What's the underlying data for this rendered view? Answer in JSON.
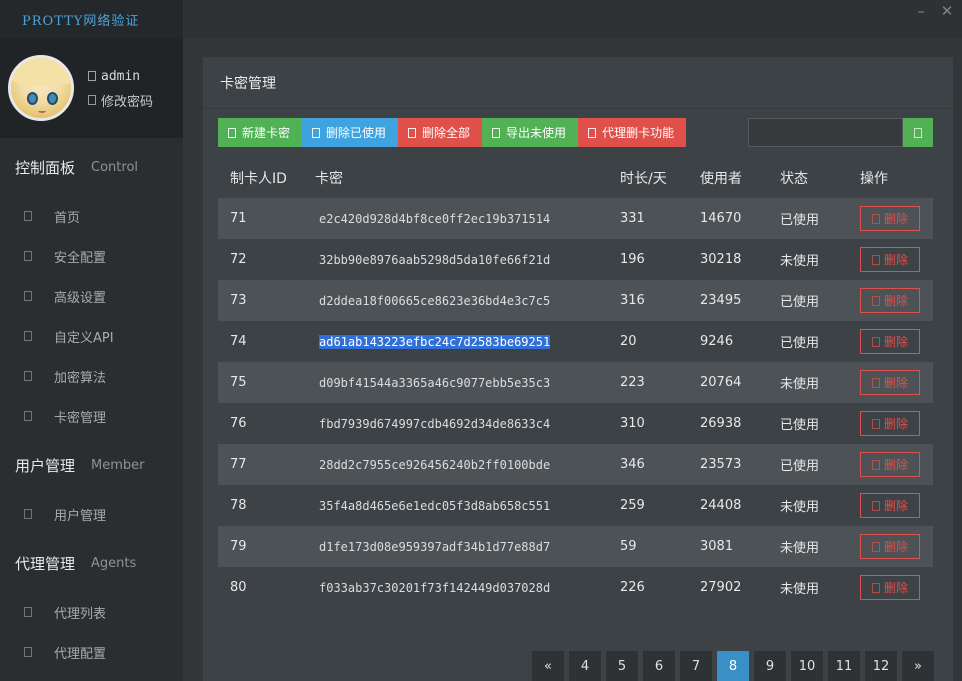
{
  "brand": "PROTTY网络验证",
  "window_controls": {
    "minimize": "–",
    "close": "✕"
  },
  "profile": {
    "username": "admin",
    "change_password": "修改密码"
  },
  "sidebar": {
    "groups": [
      {
        "title": "控制面板",
        "en": "Control",
        "items": [
          "首页",
          "安全配置",
          "高级设置",
          "自定义API",
          "加密算法",
          "卡密管理"
        ]
      },
      {
        "title": "用户管理",
        "en": "Member",
        "items": [
          "用户管理"
        ]
      },
      {
        "title": "代理管理",
        "en": "Agents",
        "items": [
          "代理列表",
          "代理配置"
        ]
      }
    ]
  },
  "panel": {
    "title": "卡密管理"
  },
  "toolbar": {
    "new_card": "新建卡密",
    "delete_used": "删除已使用",
    "delete_all": "删除全部",
    "export_unused": "导出未使用",
    "agent_delete": "代理删卡功能"
  },
  "search": {
    "value": ""
  },
  "table": {
    "headers": {
      "id": "制卡人ID",
      "key": "卡密",
      "duration": "时长/天",
      "user": "使用者",
      "status": "状态",
      "op": "操作"
    },
    "delete_label": "删除",
    "rows": [
      {
        "id": "71",
        "key": "e2c420d928d4bf8ce0ff2ec19b371514",
        "duration": "331",
        "user": "14670",
        "status": "已使用"
      },
      {
        "id": "72",
        "key": "32bb90e8976aab5298d5da10fe66f21d",
        "duration": "196",
        "user": "30218",
        "status": "未使用"
      },
      {
        "id": "73",
        "key": "d2ddea18f00665ce8623e36bd4e3c7c5",
        "duration": "316",
        "user": "23495",
        "status": "已使用"
      },
      {
        "id": "74",
        "key": "ad61ab143223efbc24c7d2583be69251",
        "duration": "20",
        "user": "9246",
        "status": "已使用",
        "selected": true
      },
      {
        "id": "75",
        "key": "d09bf41544a3365a46c9077ebb5e35c3",
        "duration": "223",
        "user": "20764",
        "status": "未使用"
      },
      {
        "id": "76",
        "key": "fbd7939d674997cdb4692d34de8633c4",
        "duration": "310",
        "user": "26938",
        "status": "已使用"
      },
      {
        "id": "77",
        "key": "28dd2c7955ce926456240b2ff0100bde",
        "duration": "346",
        "user": "23573",
        "status": "已使用"
      },
      {
        "id": "78",
        "key": "35f4a8d465e6e1edc05f3d8ab658c551",
        "duration": "259",
        "user": "24408",
        "status": "未使用"
      },
      {
        "id": "79",
        "key": "d1fe173d08e959397adf34b1d77e88d7",
        "duration": "59",
        "user": "3081",
        "status": "未使用"
      },
      {
        "id": "80",
        "key": "f033ab37c30201f73f142449d037028d",
        "duration": "226",
        "user": "27902",
        "status": "未使用"
      }
    ]
  },
  "pagination": {
    "prev": "«",
    "next": "»",
    "pages": [
      "4",
      "5",
      "6",
      "7",
      "8",
      "9",
      "10",
      "11",
      "12"
    ],
    "current": "8"
  }
}
